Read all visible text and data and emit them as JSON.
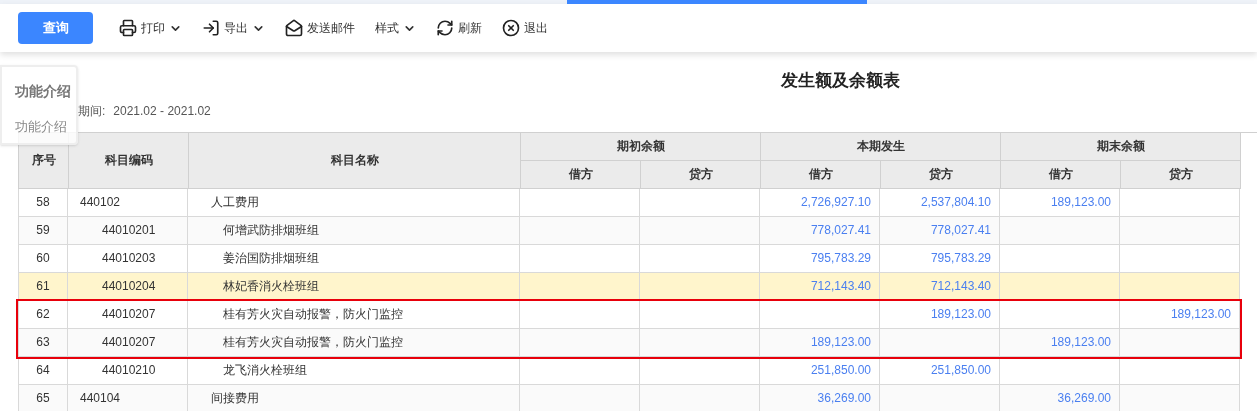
{
  "toolbar": [
    {
      "kind": "primary",
      "label": "查询"
    },
    {
      "kind": "tool",
      "label": "打印",
      "dropdown": true
    },
    {
      "kind": "tool",
      "label": "导出",
      "dropdown": true
    },
    {
      "kind": "tool",
      "label": "发送邮件",
      "dropdown": false
    },
    {
      "kind": "tool",
      "label": "样式",
      "dropdown": true
    },
    {
      "kind": "tool",
      "label": "刷新",
      "dropdown": false
    },
    {
      "kind": "tool",
      "label": "退出",
      "dropdown": false
    }
  ],
  "help_panel": {
    "title": "功能介绍",
    "link": "功能介绍"
  },
  "report": {
    "title": "发生额及余额表",
    "period_label": "期间:",
    "period_value": "2021.02 - 2021.02"
  },
  "table": {
    "columns": [
      "序号",
      "科目编码",
      "科目名称"
    ],
    "groups": [
      {
        "label": "期初余额",
        "columns": [
          "借方",
          "贷方"
        ]
      },
      {
        "label": "本期发生",
        "columns": [
          "借方",
          "贷方"
        ]
      },
      {
        "label": "期末余额",
        "columns": [
          "借方",
          "贷方"
        ]
      }
    ],
    "rows": [
      {
        "no": "58",
        "code": "440102",
        "name": "人工费用",
        "selected": false,
        "boxed": false,
        "amounts": {
          "period_debit": "2,726,927.10",
          "period_credit": "2,537,804.10",
          "closing_debit": "189,123.00"
        },
        "children": [
          {
            "no": "59",
            "code": "44010201",
            "name": "何增武防排烟班组",
            "selected": false,
            "boxed": false,
            "amounts": {
              "period_debit": "778,027.41",
              "period_credit": "778,027.41"
            }
          },
          {
            "no": "60",
            "code": "44010203",
            "name": "姜治国防排烟班组",
            "selected": false,
            "boxed": false,
            "amounts": {
              "period_debit": "795,783.29",
              "period_credit": "795,783.29"
            }
          },
          {
            "no": "61",
            "code": "44010204",
            "name": "林妃香消火栓班组",
            "selected": true,
            "boxed": false,
            "amounts": {
              "period_debit": "712,143.40",
              "period_credit": "712,143.40"
            }
          },
          {
            "no": "62",
            "code": "44010207",
            "name": "桂有芳火灾自动报警，防火门监控",
            "selected": false,
            "boxed": true,
            "amounts": {
              "period_credit": "189,123.00",
              "closing_credit": "189,123.00"
            }
          },
          {
            "no": "63",
            "code": "44010207",
            "name": "桂有芳火灾自动报警，防火门监控",
            "selected": false,
            "boxed": true,
            "amounts": {
              "period_debit": "189,123.00",
              "closing_debit": "189,123.00"
            }
          },
          {
            "no": "64",
            "code": "44010210",
            "name": "龙飞消火栓班组",
            "selected": false,
            "boxed": false,
            "amounts": {
              "period_debit": "251,850.00",
              "period_credit": "251,850.00"
            }
          }
        ]
      },
      {
        "no": "65",
        "code": "440104",
        "name": "间接费用",
        "selected": false,
        "boxed": false,
        "amounts": {
          "period_debit": "36,269.00",
          "closing_debit": "36,269.00"
        }
      }
    ]
  }
}
